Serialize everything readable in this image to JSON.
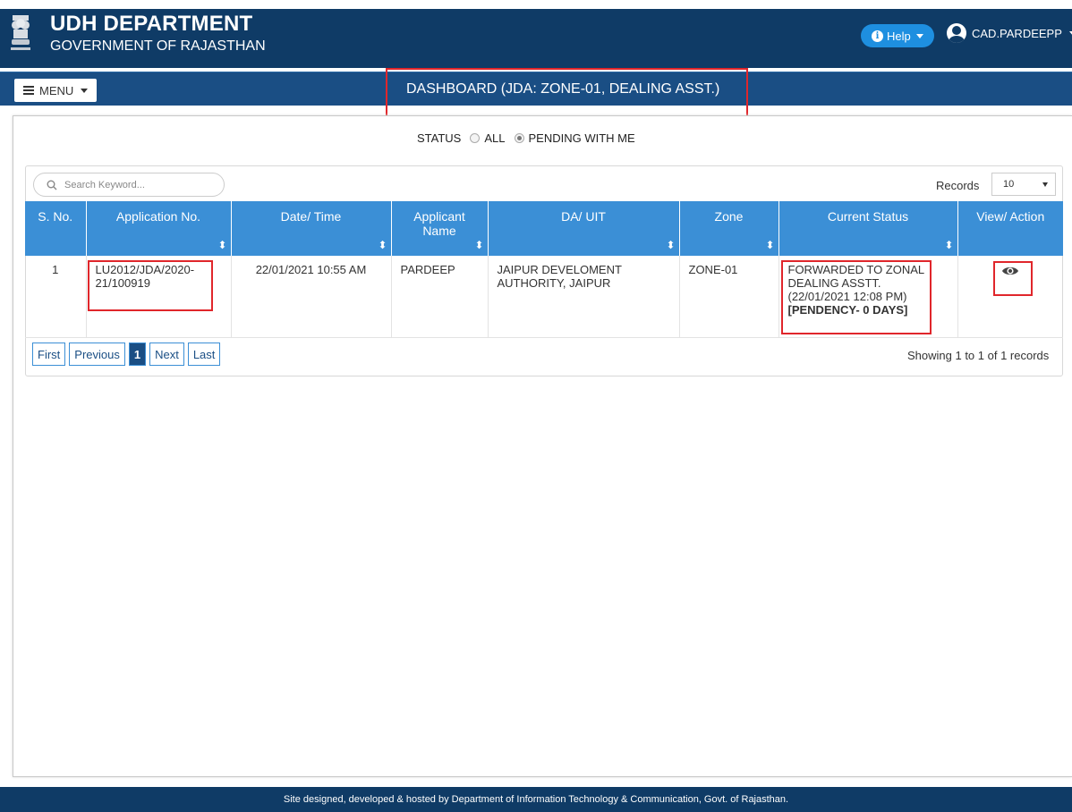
{
  "header": {
    "title": "UDH DEPARTMENT",
    "subtitle": "GOVERNMENT OF RAJASTHAN",
    "help_label": "Help",
    "user_name": "CAD.PARDEEPP"
  },
  "navbar": {
    "menu_label": "MENU",
    "dashboard_title": "DASHBOARD (JDA: ZONE-01, DEALING ASST.)"
  },
  "status_filter": {
    "label": "STATUS",
    "options": [
      "ALL",
      "PENDING WITH ME"
    ],
    "selected": "PENDING WITH ME"
  },
  "search": {
    "placeholder": "Search Keyword..."
  },
  "records": {
    "label": "Records",
    "value": "10"
  },
  "table": {
    "headers": [
      "S. No.",
      "Application No.",
      "Date/ Time",
      "Applicant Name",
      "DA/ UIT",
      "Zone",
      "Current Status",
      "View/ Action"
    ],
    "header_applicant_line1": "Applicant",
    "header_applicant_line2": "Name",
    "rows": [
      {
        "sno": "1",
        "app_no_line1": "LU2012/JDA/2020-",
        "app_no_line2": "21/100919",
        "datetime": "22/01/2021 10:55 AM",
        "applicant": "PARDEEP",
        "da_line1": "JAIPUR DEVELOMENT",
        "da_line2": "AUTHORITY, JAIPUR",
        "zone": "ZONE-01",
        "status_line1": "FORWARDED TO ZONAL",
        "status_line2": "DEALING ASSTT.",
        "status_line3": "(22/01/2021 12:08 PM)",
        "status_line4": "[PENDENCY- 0 DAYS]",
        "action_icon": "eye-icon"
      }
    ]
  },
  "pagination": {
    "first": "First",
    "previous": "Previous",
    "current": "1",
    "next": "Next",
    "last": "Last",
    "summary": "Showing 1 to 1 of 1 records"
  },
  "footer": {
    "text": "Site designed, developed & hosted by Department of Information Technology & Communication, Govt. of Rajasthan."
  },
  "colors": {
    "header_bg": "#0f3b66",
    "navbar_bg": "#1a4e84",
    "table_header_bg": "#3b8fd6",
    "help_button": "#1e8fe0",
    "highlight_red": "#e0262b"
  }
}
